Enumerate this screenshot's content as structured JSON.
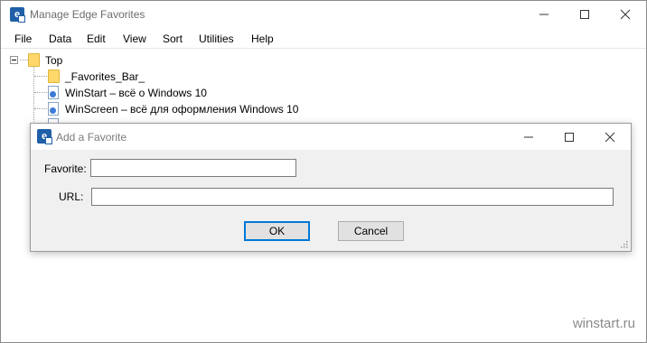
{
  "main": {
    "title": "Manage Edge Favorites",
    "icon_letter": "e",
    "controls": {
      "minimize": "minimize-icon",
      "maximize": "maximize-icon",
      "close": "close-icon"
    }
  },
  "menu": [
    "File",
    "Data",
    "Edit",
    "View",
    "Sort",
    "Utilities",
    "Help"
  ],
  "tree": {
    "root": "Top",
    "children": [
      {
        "label": "_Favorites_Bar_",
        "icon": "folder-icon"
      },
      {
        "label": "WinStart – всё о Windows 10",
        "icon": "page-icon"
      },
      {
        "label": "WinScreen – всё для оформления Windows 10",
        "icon": "page-icon"
      }
    ]
  },
  "dialog": {
    "title": "Add a Favorite",
    "favorite_label": "Favorite:",
    "favorite_value": "",
    "url_label": "URL:",
    "url_value": "",
    "ok_label": "OK",
    "cancel_label": "Cancel"
  },
  "watermark": "winstart.ru",
  "colors": {
    "accent": "#0078d7",
    "folder": "#ffd86b",
    "dialog_bg": "#f0f0f0"
  }
}
